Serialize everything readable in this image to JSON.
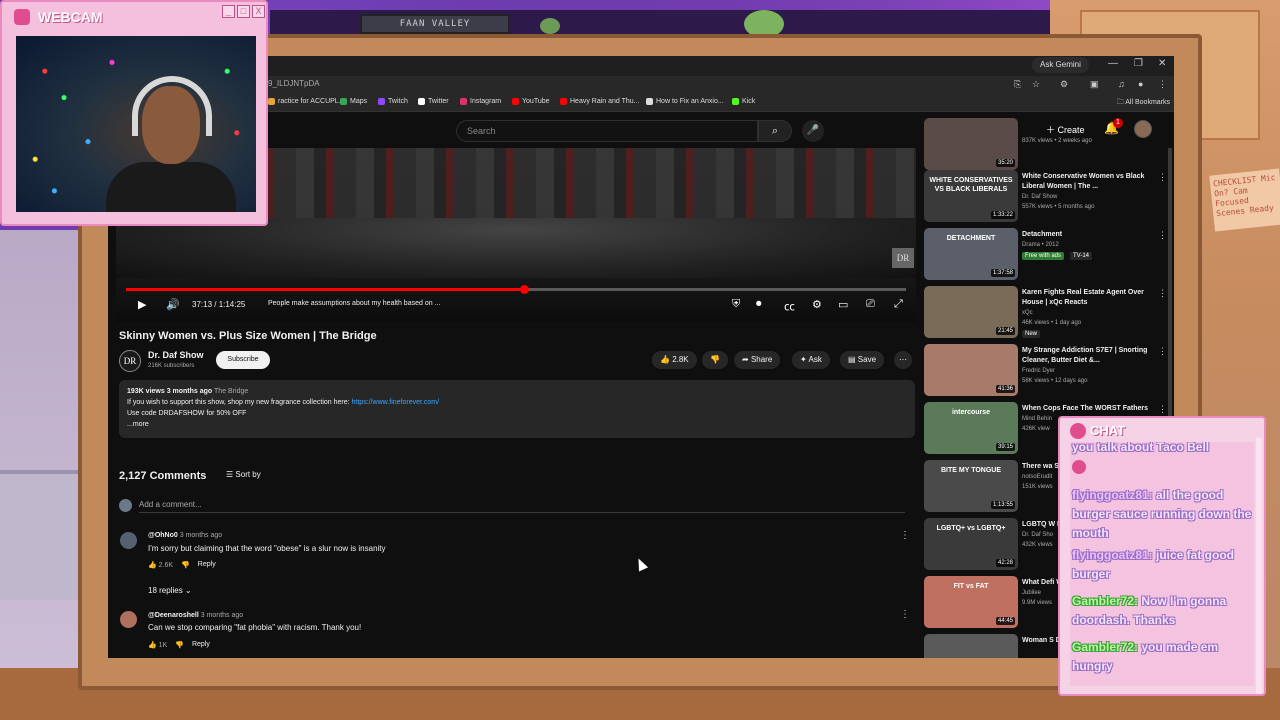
{
  "webcam": {
    "title": "WEBCAM",
    "min": "_",
    "max": "□",
    "close": "X"
  },
  "room": {
    "shelf_sign": "FAAN VALLEY",
    "note": "CHECKLIST Mic On? Cam Focused Scenes Ready"
  },
  "browser": {
    "gemini": "Ask Gemini",
    "url": "9_ILDJNTpDA",
    "bookmarks": [
      {
        "label": "ractice for ACCUPL...",
        "color": "#e8a23a"
      },
      {
        "label": "Maps",
        "color": "#34a853"
      },
      {
        "label": "Twitch",
        "color": "#9146ff"
      },
      {
        "label": "Twitter",
        "color": "#ffffff"
      },
      {
        "label": "Instagram",
        "color": "#e1306c"
      },
      {
        "label": "YouTube",
        "color": "#ff0000"
      },
      {
        "label": "Heavy Rain and Thu...",
        "color": "#ff0000"
      },
      {
        "label": "How to Fix an Anxio...",
        "color": "#dddddd"
      },
      {
        "label": "Kick",
        "color": "#53fc18"
      }
    ],
    "all_bookmarks": "All Bookmarks"
  },
  "header": {
    "search_placeholder": "Search",
    "create": "Create",
    "notif_count": "1"
  },
  "player": {
    "time": "37:13 / 1:14:25",
    "chapter": "People make assumptions about my health based on ...",
    "progress": 0.51,
    "logo": "DR"
  },
  "video": {
    "title": "Skinny Women vs. Plus Size Women | The Bridge",
    "channel": "Dr. Daf Show",
    "channel_logo": "DR",
    "subs": "216K subscribers",
    "subscribe": "Subscribe",
    "likes": "2.8K",
    "share": "Share",
    "ask": "Ask",
    "save": "Save",
    "views_line": "193K views  3 months ago",
    "tag": "The Bridge",
    "desc_line1": "If you wish to support this show, shop my new fragrance collection here: ",
    "desc_link": "https://www.fineforever.com/",
    "desc_line2": "Use code DRDAFSHOW for 50% OFF",
    "more": "...more"
  },
  "comments": {
    "count": "2,127 Comments",
    "sort": "Sort by",
    "add_placeholder": "Add a comment...",
    "items": [
      {
        "user": "@OhNo0",
        "ago": "3 months ago",
        "text": "I'm sorry but claiming that the word \"obese\" is a slur now is insanity",
        "likes": "2.6K",
        "reply": "Reply",
        "replies": "18 replies"
      },
      {
        "user": "@Deenaroshell",
        "ago": "3 months ago",
        "text": "Can we stop comparing \"fat phobia\" with racism. Thank you!",
        "likes": "1K",
        "reply": "Reply"
      }
    ]
  },
  "recs": [
    {
      "title": "",
      "channel": "",
      "meta": "837K views • 2 weeks ago",
      "duration": "35:20",
      "thumb": "#5a4a48"
    },
    {
      "title": "White Conservative Women vs Black Liberal Women | The ...",
      "channel": "Dr. Daf Show",
      "meta": "557K views • 5 months ago",
      "duration": "1:33:22",
      "thumb": "#3a3a3a",
      "thumb_text": "WHITE CONSERVATIVES VS BLACK LIBERALS"
    },
    {
      "title": "Detachment",
      "channel": "Drama • 2012",
      "badge_free": "Free with ads",
      "badge": "TV-14",
      "duration": "1:37:58",
      "thumb": "#5a5f6a",
      "thumb_text": "DETACHMENT"
    },
    {
      "title": "Karen Fights Real Estate Agent Over House | xQc Reacts",
      "channel": "xQc",
      "meta": "46K views • 1 day ago",
      "badge": "New",
      "duration": "21:45",
      "thumb": "#7a6a58"
    },
    {
      "title": "My Strange Addiction S7E7 | Snorting Cleaner, Butter Diet &...",
      "channel": "Fredric Dyer",
      "meta": "58K views • 12 days ago",
      "duration": "41:36",
      "thumb": "#a87a6a"
    },
    {
      "title": "When Cops Face The WORST Fathers",
      "channel": "Mind Behin",
      "meta": "426K view",
      "duration": "39:15",
      "thumb": "#5a7a5a",
      "thumb_text": "intercourse"
    },
    {
      "title": "There wa Say - Defe",
      "channel": "notsoErudit",
      "meta": "151K views",
      "duration": "1:13:55",
      "thumb": "#4a4a4a",
      "thumb_text": "BITE MY TONGUE"
    },
    {
      "title": "LGBTQ W LGBTQ W",
      "channel": "Dr. Daf Sho",
      "meta": "432K views",
      "duration": "42:28",
      "thumb": "#3a3a3a",
      "thumb_text": "LGBTQ+ vs LGBTQ+"
    },
    {
      "title": "What Defi Women v",
      "channel": "Jubilee",
      "meta": "9.9M views",
      "duration": "44:45",
      "thumb": "#c07060",
      "thumb_text": "FIT vs FAT"
    },
    {
      "title": "Woman S During Ar",
      "channel": "",
      "meta": "",
      "duration": "",
      "thumb": "#5a5a5a"
    }
  ],
  "chat": {
    "title": "CHAT",
    "messages": [
      {
        "user": "",
        "text": "you talk about Taco Bell"
      },
      {
        "user": "flyinggoatz81:",
        "text": " all the good burger sauce running down the mouth"
      },
      {
        "user": "flyinggoatz81:",
        "text": " juice fat good burger"
      },
      {
        "user": "Gambler72:",
        "text": " Now I'm gonna doordash. Thanks"
      },
      {
        "user": "Gambler72:",
        "text": " you made em hungry"
      }
    ]
  }
}
